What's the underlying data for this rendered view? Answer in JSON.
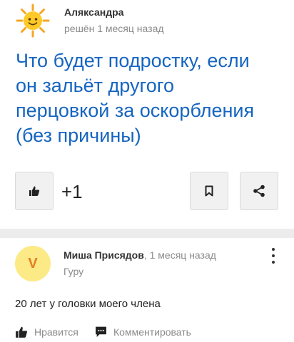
{
  "question": {
    "author": "Аляксандра",
    "time": "решён 1 месяц назад",
    "title": "Что будет подростку, если он зальёт другого перцовкой за оскорбления (без причины)",
    "like_count": "+1",
    "icons": {
      "avatar": "sun-avatar-icon",
      "like": "thumbs-up-icon",
      "bookmark": "bookmark-icon",
      "share": "share-icon"
    }
  },
  "answer": {
    "avatar_letter": "V",
    "author": "Миша Присядов",
    "time": ", 1 месяц назад",
    "rank": "Гуру",
    "text": "20 лет у головки моего члена",
    "like_label": "Нравится",
    "comment_label": "Комментировать",
    "icons": {
      "menu": "more-vertical-icon",
      "like": "thumbs-up-icon",
      "comment": "comment-icon"
    }
  },
  "colors": {
    "title": "#1565c0",
    "muted": "#8a8a8a",
    "avatar_bg": "#fcea86",
    "avatar_letter": "#e67e22",
    "divider": "#ececec"
  }
}
